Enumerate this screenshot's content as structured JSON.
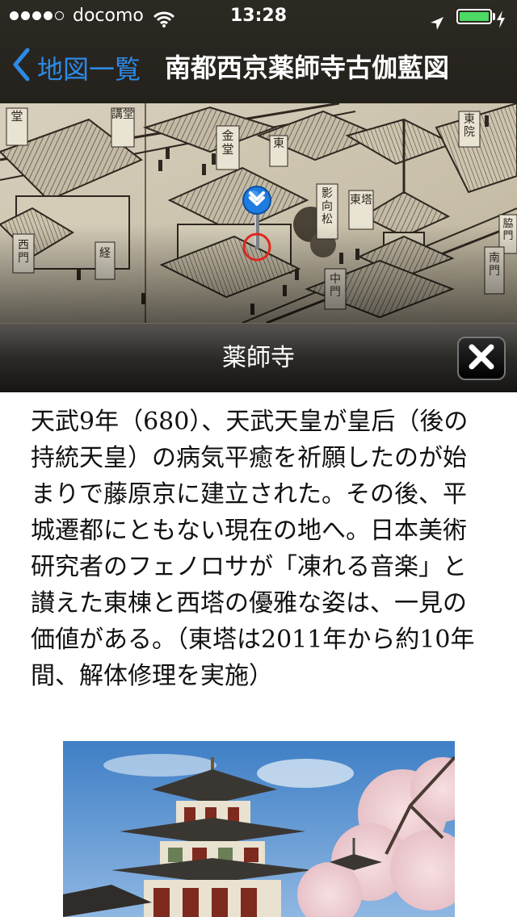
{
  "status_bar": {
    "carrier": "docomo",
    "time": "13:28",
    "battery_level": 1.0,
    "icons": [
      "signal-dots-icon",
      "wifi-icon",
      "location-arrow-icon",
      "battery-icon",
      "charging-bolt-icon"
    ]
  },
  "nav": {
    "back_label": "地図一覧",
    "title": "南都西京薬師寺古伽藍図"
  },
  "map": {
    "labels": [
      "堂",
      "講堂",
      "金堂",
      "東院",
      "東",
      "影向松",
      "東塔",
      "西門",
      "中門",
      "脇門",
      "南門",
      "経"
    ]
  },
  "detail": {
    "title": "薬師寺",
    "description": "天武9年（680）、天武天皇が皇后（後の持統天皇）の病気平癒を祈願したのが始まりで藤原京に建立された。その後、平城遷都にともない現在の地へ。日本美術研究者のフェノロサが「凍れる音楽」と讃えた東棟と西塔の優雅な姿は、一見の価値がある。（東塔は2011年から約10年間、解体修理を実施）"
  },
  "colors": {
    "accent_blue": "#2d8ae6",
    "battery_green": "#4cd964",
    "pin_blue": "#1e7be0",
    "target_red": "#e0261d"
  }
}
